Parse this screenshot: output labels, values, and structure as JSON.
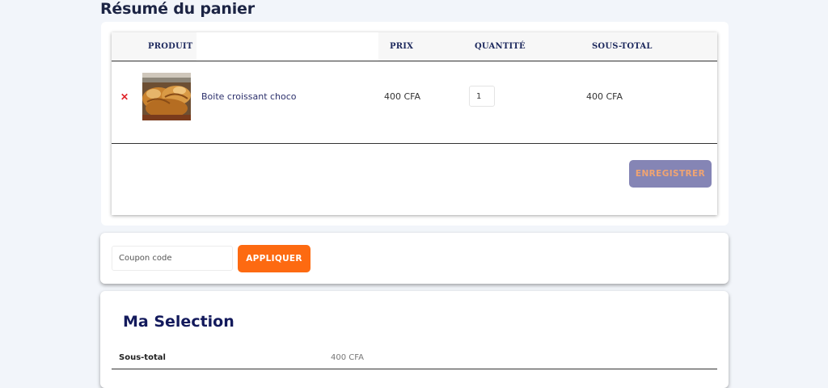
{
  "page": {
    "title": "Résumé du panier"
  },
  "cart": {
    "columns": {
      "product": "PRODUIT",
      "price": "PRIX",
      "quantity": "QUANTITÉ",
      "subtotal": "SOUS-TOTAL"
    },
    "items": [
      {
        "remove_icon": "close-icon",
        "name": "Boite croissant choco",
        "price": "400 CFA",
        "quantity": "1",
        "subtotal": "400 CFA"
      }
    ],
    "save_label": "ENREGISTRER"
  },
  "coupon": {
    "placeholder": "Coupon code",
    "apply_label": "APPLIQUER"
  },
  "summary": {
    "title": "Ma Selection",
    "subtotal_label": "Sous-total",
    "subtotal_value": "400 CFA"
  },
  "colors": {
    "accent": "#fd6a11",
    "save_button": "#8585b5",
    "remove": "#e0242a",
    "heading": "#131a5c"
  }
}
